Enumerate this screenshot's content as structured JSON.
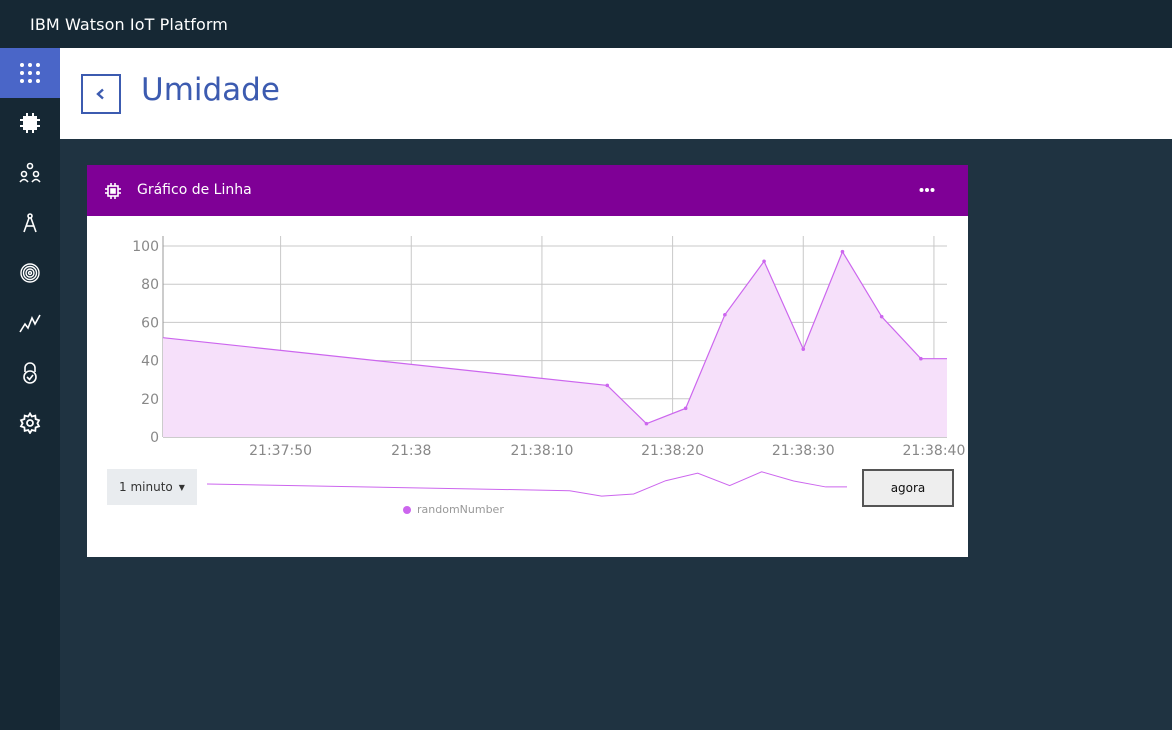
{
  "app": {
    "title": "IBM Watson IoT Platform"
  },
  "sidebar": {
    "items": [
      {
        "icon": "apps-grid-icon",
        "active": true
      },
      {
        "icon": "device-chip-icon"
      },
      {
        "icon": "members-icon"
      },
      {
        "icon": "compass-icon"
      },
      {
        "icon": "fingerprint-icon"
      },
      {
        "icon": "analytics-icon"
      },
      {
        "icon": "security-lock-icon"
      },
      {
        "icon": "settings-gear-icon"
      }
    ]
  },
  "header": {
    "title": "Umidade",
    "back_icon": "chevron-left-icon"
  },
  "card": {
    "title": "Gráfico de Linha",
    "header_color": "#7f0096",
    "icon": "device-chip-icon",
    "menu_icon": "more-horizontal-icon"
  },
  "controls": {
    "range_label": "1 minuto",
    "now_label": "agora"
  },
  "chart_data": {
    "type": "area",
    "x_ticks": [
      "21:37:50",
      "21:38",
      "21:38:10",
      "21:38:20",
      "21:38:30",
      "21:38:40"
    ],
    "y_ticks": [
      0,
      20,
      40,
      60,
      80,
      100
    ],
    "ylim": [
      0,
      100
    ],
    "xlim": [
      "21:37:41",
      "21:38:41"
    ],
    "grid": true,
    "legend_position": "bottom",
    "color": "#cc66ee",
    "fill_color": "#f6e0fa",
    "series": [
      {
        "name": "randomNumber",
        "points": [
          {
            "x": "21:37:41",
            "y": 52
          },
          {
            "x": "21:38:15",
            "y": 27
          },
          {
            "x": "21:38:18",
            "y": 7
          },
          {
            "x": "21:38:21",
            "y": 15
          },
          {
            "x": "21:38:24",
            "y": 64
          },
          {
            "x": "21:38:27",
            "y": 92
          },
          {
            "x": "21:38:30",
            "y": 46
          },
          {
            "x": "21:38:33",
            "y": 97
          },
          {
            "x": "21:38:36",
            "y": 63
          },
          {
            "x": "21:38:39",
            "y": 41
          },
          {
            "x": "21:38:41",
            "y": 41
          }
        ]
      }
    ]
  }
}
